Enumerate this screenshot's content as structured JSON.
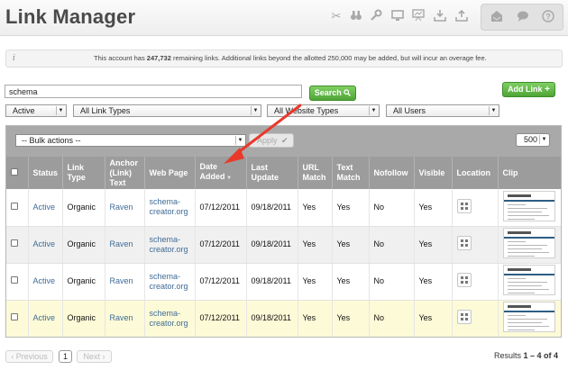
{
  "app": {
    "title": "Link Manager"
  },
  "header": {
    "tools": [
      "scissors-icon",
      "binoculars-icon",
      "wrench-icon",
      "monitor-icon",
      "presentation-icon",
      "download-icon",
      "upload-icon"
    ],
    "right_tools": [
      "inbox-icon",
      "chat-icon",
      "help-icon"
    ]
  },
  "notice": {
    "prefix": "This account has ",
    "count": "247,732",
    "suffix": " remaining links. Additional links beyond the allotted 250,000 may be added, but will incur an overage fee."
  },
  "search": {
    "value": "schema",
    "button_label": "Search",
    "button_icon": "search-icon"
  },
  "add_link": {
    "label": "Add Link",
    "icon": "plus-icon"
  },
  "filters": {
    "status": "Active",
    "link_types": "All Link Types",
    "website_types": "All Website Types",
    "users": "All Users"
  },
  "toolbar": {
    "bulk_actions": "-- Bulk actions --",
    "apply_label": "Apply",
    "per_page": "500"
  },
  "table": {
    "columns": [
      "Status",
      "Link Type",
      "Anchor (Link) Text",
      "Web Page",
      "Date Added",
      "Last Update",
      "URL Match",
      "Text Match",
      "Nofollow",
      "Visible",
      "Location",
      "Clip"
    ],
    "rows": [
      {
        "status": "Active",
        "link_type": "Organic",
        "anchor": "Raven",
        "web_page": "schema-creator.org",
        "date_added": "07/12/2011",
        "last_update": "09/18/2011",
        "url_match": "Yes",
        "text_match": "Yes",
        "nofollow": "No",
        "visible": "Yes"
      },
      {
        "status": "Active",
        "link_type": "Organic",
        "anchor": "Raven",
        "web_page": "schema-creator.org",
        "date_added": "07/12/2011",
        "last_update": "09/18/2011",
        "url_match": "Yes",
        "text_match": "Yes",
        "nofollow": "No",
        "visible": "Yes"
      },
      {
        "status": "Active",
        "link_type": "Organic",
        "anchor": "Raven",
        "web_page": "schema-creator.org",
        "date_added": "07/12/2011",
        "last_update": "09/18/2011",
        "url_match": "Yes",
        "text_match": "Yes",
        "nofollow": "No",
        "visible": "Yes"
      },
      {
        "status": "Active",
        "link_type": "Organic",
        "anchor": "Raven",
        "web_page": "schema-creator.org",
        "date_added": "07/12/2011",
        "last_update": "09/18/2011",
        "url_match": "Yes",
        "text_match": "Yes",
        "nofollow": "No",
        "visible": "Yes"
      }
    ]
  },
  "pagination": {
    "previous": "Previous",
    "page": "1",
    "next": "Next"
  },
  "results": {
    "prefix": "Results ",
    "range": "1 – 4 of 4"
  },
  "colors": {
    "accent_green": "#4ea536",
    "link_blue": "#3f6c97",
    "arrow_red": "#e8392b",
    "highlight_row": "#fdfad7"
  }
}
